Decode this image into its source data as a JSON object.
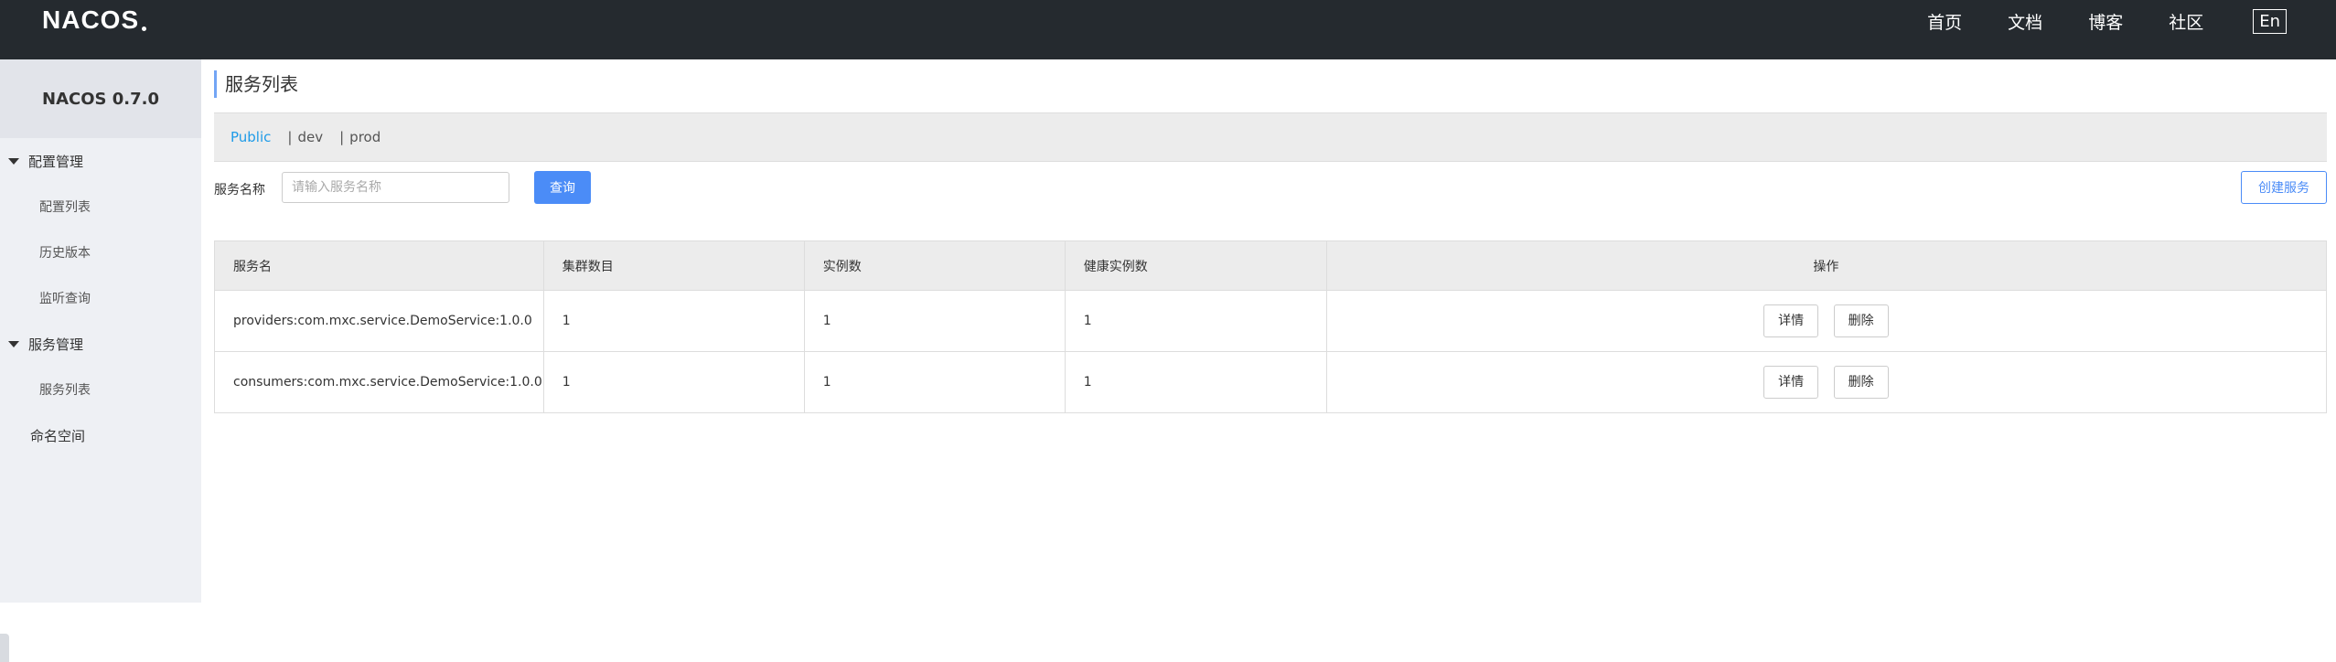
{
  "header": {
    "logo_text": "NACOS",
    "nav": [
      "首页",
      "文档",
      "博客",
      "社区"
    ],
    "lang_button": "En"
  },
  "sidebar": {
    "title": "NACOS 0.7.0",
    "groups": [
      {
        "label": "配置管理",
        "items": [
          "配置列表",
          "历史版本",
          "监听查询"
        ]
      },
      {
        "label": "服务管理",
        "items": [
          "服务列表"
        ]
      }
    ],
    "namespace_label": "命名空间"
  },
  "main": {
    "page_title": "服务列表",
    "namespaces": [
      {
        "label": "Public",
        "active": true
      },
      {
        "label": "dev",
        "active": false
      },
      {
        "label": "prod",
        "active": false
      }
    ],
    "search": {
      "label": "服务名称",
      "placeholder": "请输入服务名称",
      "value": "",
      "query_button": "查询"
    },
    "create_button": "创建服务",
    "table": {
      "columns": [
        "服务名",
        "集群数目",
        "实例数",
        "健康实例数",
        "操作"
      ],
      "rows": [
        {
          "name": "providers:com.mxc.service.DemoService:1.0.0",
          "clusters": "1",
          "instances": "1",
          "healthy": "1"
        },
        {
          "name": "consumers:com.mxc.service.DemoService:1.0.0",
          "clusters": "1",
          "instances": "1",
          "healthy": "1"
        }
      ],
      "detail_button": "详情",
      "delete_button": "删除"
    }
  },
  "colors": {
    "topbar": "#252a2f",
    "accent": "#4b8cf7",
    "active_namespace": "#1e9be8",
    "sidebar_bg": "#eef0f4"
  }
}
